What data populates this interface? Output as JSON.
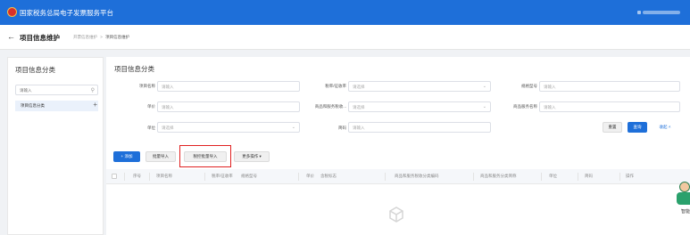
{
  "topbar": {
    "title": "国家税务总局电子发票服务平台"
  },
  "subheader": {
    "page_title": "项目信息维护",
    "breadcrumb": [
      "开票信息维护",
      ">",
      "项目信息维护"
    ]
  },
  "left": {
    "title": "项目信息分类",
    "search_placeholder": "请输入",
    "tree_item": "项目信息分类"
  },
  "main": {
    "title": "项目信息分类",
    "form": {
      "item_name": {
        "label": "项目名称",
        "placeholder": "请输入"
      },
      "tax_rate": {
        "label": "税率/征收率",
        "placeholder": "请选择"
      },
      "spec_model": {
        "label": "规格型号",
        "placeholder": "请输入"
      },
      "unit_price": {
        "label": "单价",
        "placeholder": "请输入"
      },
      "tax_code": {
        "label": "商品和服务税收...",
        "placeholder": "请选择"
      },
      "goods_name": {
        "label": "商品服务名称",
        "placeholder": "请输入"
      },
      "unit": {
        "label": "单位",
        "placeholder": "请选择"
      },
      "abbr": {
        "label": "简码",
        "placeholder": "请输入"
      }
    },
    "buttons": {
      "reset": "重置",
      "query": "查询",
      "collapse": "收起",
      "add": "添加",
      "batch_import": "批量导入",
      "template_import": "税控批量导入",
      "more_actions": "更多操作"
    }
  },
  "table": {
    "headers": [
      "序号",
      "项目名称",
      "税率/征收率",
      "规格型号",
      "单价",
      "含税标志",
      "商品和服务税收分类编码",
      "商品和服务分类简称",
      "单位",
      "简码",
      "操作"
    ]
  },
  "assistant": {
    "label": "智能"
  },
  "colors": {
    "brand": "#1e6fd9",
    "highlight": "#e02020"
  }
}
